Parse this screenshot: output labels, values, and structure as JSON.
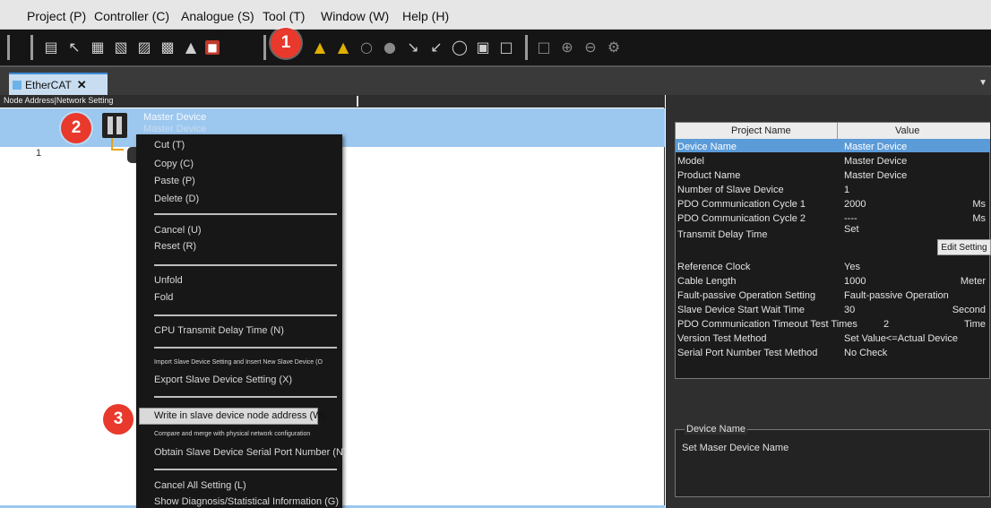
{
  "menubar": {
    "items": [
      {
        "label": "Project (P)"
      },
      {
        "label": "Controller (C)"
      },
      {
        "label": "Analogue (S)"
      },
      {
        "label": "Tool (T)"
      },
      {
        "label": "Window (W)"
      },
      {
        "label": "Help (H)"
      }
    ]
  },
  "toolbar": {
    "icons": [
      "print-icon",
      "wrench-icon",
      "compare-icon",
      "cross-reference-icon",
      "watch-icon",
      "network-icon",
      "find-icon",
      "rom-icon",
      "warning-icon",
      "warning-cross-icon",
      "bell-icon",
      "online-icon",
      "transfer-to-icon",
      "transfer-from-icon",
      "sync-icon",
      "run-icon",
      "device-icon",
      "zoom-fit-icon",
      "zoom-in-icon",
      "zoom-out-icon",
      "settings-icon"
    ]
  },
  "tabs": [
    {
      "label": "EtherCAT"
    }
  ],
  "left_panel": {
    "column_header": "Node Address|Network Setting",
    "master_title": "Master Device",
    "master_subtitle": "Master Device",
    "row_number": "1"
  },
  "context_menu": {
    "items": {
      "cut": "Cut (T)",
      "copy": "Copy (C)",
      "paste": "Paste (P)",
      "delete": "Delete (D)",
      "cancel": "Cancel (U)",
      "reset": "Reset (R)",
      "unfold": "Unfold",
      "fold": "Fold",
      "cpu_delay": "CPU Transmit Delay Time (N)",
      "import_slave": "Import Slave Device Setting and Insert New Slave Device (O",
      "export_slave": "Export Slave Device Setting (X)",
      "write_node": "Write in slave device node address (W)",
      "compare_merge": "Compare and merge with physical network configuration",
      "obtain_serial": "Obtain Slave Device Serial Port Number (N)",
      "cancel_all": "Cancel All Setting (L)",
      "show_diag": "Show Diagnosis/Statistical Information (G)"
    }
  },
  "badges": {
    "step1": "1",
    "step2": "2",
    "step3": "3"
  },
  "properties": {
    "header_name": "Project Name",
    "header_value": "Value",
    "rows": [
      {
        "name": "Device Name",
        "value": "Master Device",
        "unit": ""
      },
      {
        "name": "Model",
        "value": "Master Device",
        "unit": ""
      },
      {
        "name": "Product Name",
        "value": "Master Device",
        "unit": ""
      },
      {
        "name": "Number of Slave Device",
        "value": "1",
        "unit": ""
      },
      {
        "name": "PDO Communication Cycle 1",
        "value": "2000",
        "unit": "Ms"
      },
      {
        "name": "PDO Communication Cycle 2",
        "value": "----",
        "unit": "Ms"
      },
      {
        "name": "Transmit Delay Time",
        "value": "Set",
        "unit": ""
      },
      {
        "name": "Reference Clock",
        "value": "Yes",
        "unit": ""
      },
      {
        "name": "Cable Length",
        "value": "1000",
        "unit": "Meter"
      },
      {
        "name": "Fault-passive Operation Setting",
        "value": "Fault-passive Operation",
        "unit": ""
      },
      {
        "name": "Slave Device Start Wait Time",
        "value": "30",
        "unit": "Second"
      },
      {
        "name": "PDO Communication Timeout Test Times",
        "value": "2",
        "unit": "Time"
      },
      {
        "name": "Version Test Method",
        "value": "Set Value<=Actual Device",
        "unit": ""
      },
      {
        "name": "Serial Port Number Test Method",
        "value": "No Check",
        "unit": ""
      }
    ],
    "edit_button": "Edit Setting"
  },
  "description": {
    "legend": "Device Name",
    "text": "Set Maser Device Name"
  }
}
